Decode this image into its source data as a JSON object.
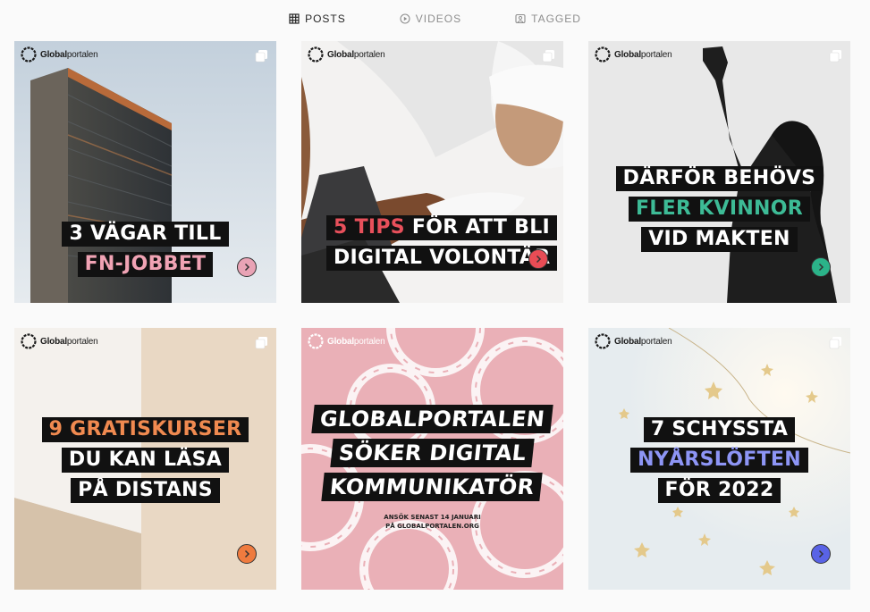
{
  "tabs": [
    {
      "label": "POSTS",
      "icon": "grid-icon",
      "active": true
    },
    {
      "label": "VIDEOS",
      "icon": "play-icon",
      "active": false
    },
    {
      "label": "TAGGED",
      "icon": "tag-icon",
      "active": false
    }
  ],
  "brand": {
    "bold": "Global",
    "regular": "portalen"
  },
  "posts": [
    {
      "lines": [
        "3 VÄGAR TILL",
        "FN-JOBBET"
      ],
      "highlight_color": "#f0a3b4",
      "arrow_color": "#e9a3b5"
    },
    {
      "lines": [
        "5 TIPS FÖR ATT BLI",
        "DIGITAL VOLONTÄR"
      ],
      "highlight_word": "5 TIPS",
      "highlight_color": "#e8505b",
      "arrow_color": "#e84c55"
    },
    {
      "lines": [
        "DÄRFÖR BEHÖVS",
        "FLER KVINNOR",
        "VID MAKTEN"
      ],
      "highlight_color": "#3dbb96",
      "arrow_color": "#2bb389"
    },
    {
      "lines": [
        "9 GRATISKURSER",
        "DU KAN LÄSA",
        "PÅ DISTANS"
      ],
      "highlight_color": "#f08a50",
      "arrow_color": "#ef7b3f"
    },
    {
      "lines": [
        "GLOBALPORTALEN",
        "SÖKER DIGITAL",
        "KOMMUNIKATÖR"
      ],
      "small_lines": [
        "ANSÖK SENAST 14 JANUARI",
        "PÅ GLOBALPORTALEN.ORG"
      ]
    },
    {
      "lines": [
        "7 SCHYSSTA",
        "NYÅRSLÖFTEN",
        "FÖR 2022"
      ],
      "highlight_color": "#8d95f5",
      "arrow_color": "#5963e6"
    }
  ],
  "colors": {
    "accent_text": "#262626",
    "muted_text": "#8e8e8e",
    "background": "#fafafa"
  }
}
